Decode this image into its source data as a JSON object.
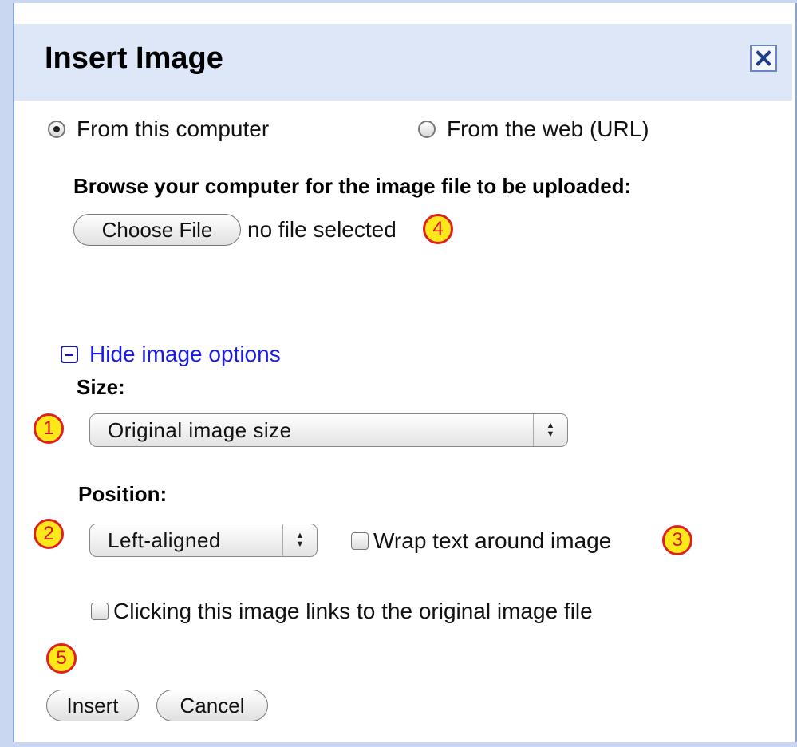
{
  "dialog": {
    "title": "Insert Image",
    "close_icon": "close-x-icon"
  },
  "source": {
    "options": [
      {
        "label": "From this computer",
        "checked": true
      },
      {
        "label": "From the web (URL)",
        "checked": false
      }
    ]
  },
  "upload": {
    "heading": "Browse your computer for the image file to be uploaded:",
    "choose_file_label": "Choose File",
    "file_status": "no file selected"
  },
  "image_options": {
    "toggle_label": "Hide image options",
    "toggle_icon": "minus-box-icon",
    "size_label": "Size:",
    "size_value": "Original image size",
    "position_label": "Position:",
    "position_value": "Left-aligned",
    "wrap_label": "Wrap text around image",
    "wrap_checked": false,
    "link_label": "Clicking this image links to the original image file",
    "link_checked": false
  },
  "actions": {
    "insert_label": "Insert",
    "cancel_label": "Cancel"
  },
  "callouts": [
    "1",
    "2",
    "3",
    "4",
    "5"
  ],
  "colors": {
    "title_bar": "#dde7f8",
    "link": "#1a1ae6",
    "callout_fill": "#ffe81a",
    "callout_border": "#e02020"
  }
}
